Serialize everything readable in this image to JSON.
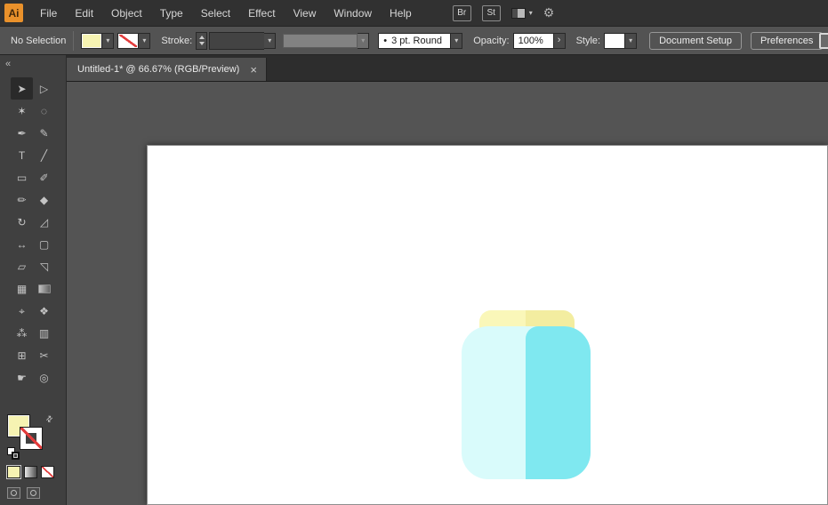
{
  "ui": {
    "caret": "▾",
    "none_color": "#E23C3C"
  },
  "menubar": {
    "logo_text": "Ai",
    "items": [
      "File",
      "Edit",
      "Object",
      "Type",
      "Select",
      "Effect",
      "View",
      "Window",
      "Help"
    ],
    "bridge_label": "Br",
    "stock_label": "St"
  },
  "controlbar": {
    "selection_status": "No Selection",
    "fill_color": "#F6F3B2",
    "stroke_label": "Stroke:",
    "brush_bullet": "•",
    "brush_value": "3 pt. Round",
    "opacity_label": "Opacity:",
    "opacity_value": "100%",
    "opacity_more": "›",
    "style_label": "Style:",
    "document_setup_label": "Document Setup",
    "preferences_label": "Preferences"
  },
  "tabbar": {
    "tabs": [
      {
        "title": "Untitled-1* @ 66.67% (RGB/Preview)",
        "close": "×"
      }
    ]
  },
  "toolbar": {
    "collapse_glyph": "«",
    "swap_glyph": "⇄",
    "tools": [
      {
        "name": "selection-tool",
        "glyph": "➤",
        "selected": "true"
      },
      {
        "name": "direct-selection-tool",
        "glyph": "▷"
      },
      {
        "name": "magic-wand-tool",
        "glyph": "✶"
      },
      {
        "name": "lasso-tool",
        "glyph": "◌"
      },
      {
        "name": "pen-tool",
        "glyph": "✒"
      },
      {
        "name": "curvature-tool",
        "glyph": "✎"
      },
      {
        "name": "type-tool",
        "glyph": "T"
      },
      {
        "name": "line-segment-tool",
        "glyph": "╱"
      },
      {
        "name": "rectangle-tool",
        "glyph": "▭"
      },
      {
        "name": "paintbrush-tool",
        "glyph": "✐"
      },
      {
        "name": "shaper-tool",
        "glyph": "✏"
      },
      {
        "name": "eraser-tool",
        "glyph": "◆"
      },
      {
        "name": "rotate-tool",
        "glyph": "↻"
      },
      {
        "name": "scale-tool",
        "glyph": "◿"
      },
      {
        "name": "width-tool",
        "glyph": "↔"
      },
      {
        "name": "free-transform-tool",
        "glyph": "▢"
      },
      {
        "name": "shape-builder-tool",
        "glyph": "▱"
      },
      {
        "name": "perspective-grid-tool",
        "glyph": "◹"
      },
      {
        "name": "mesh-tool",
        "glyph": "▦"
      },
      {
        "name": "gradient-tool",
        "glyph": "",
        "variant": "gradient-box"
      },
      {
        "name": "eyedropper-tool",
        "glyph": "⌖"
      },
      {
        "name": "blend-tool",
        "glyph": "❖"
      },
      {
        "name": "symbol-sprayer-tool",
        "glyph": "⁂"
      },
      {
        "name": "column-graph-tool",
        "glyph": "▥"
      },
      {
        "name": "artboard-tool",
        "glyph": "⊞"
      },
      {
        "name": "slice-tool",
        "glyph": "✂"
      },
      {
        "name": "hand-tool",
        "glyph": "☛"
      },
      {
        "name": "zoom-tool",
        "glyph": "◎"
      }
    ]
  },
  "canvas": {
    "background": "#545454",
    "artboard_color": "#FFFFFF",
    "jar": {
      "lid_color": "#FAF7B9",
      "lid_shade_color": "#F3EDA0",
      "body_light_color": "#D9FBFB",
      "body_dark_color": "#7FE8F0"
    }
  }
}
